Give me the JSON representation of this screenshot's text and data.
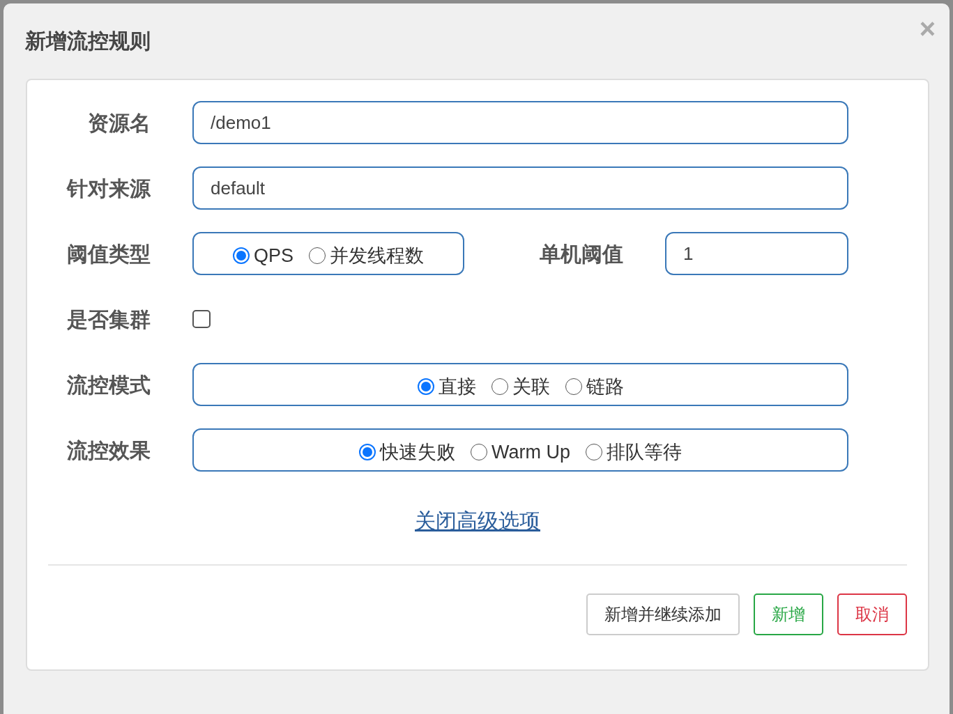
{
  "dialog": {
    "title": "新增流控规则",
    "close": "×"
  },
  "rows": [
    {
      "kind": "text",
      "label": "资源名",
      "value": "/demo1"
    },
    {
      "kind": "text",
      "label": "针对来源",
      "value": "default"
    },
    {
      "kind": "radio_input",
      "label": "阈值类型",
      "options": [
        {
          "label": "QPS",
          "selected": true
        },
        {
          "label": "并发线程数",
          "selected": false
        }
      ],
      "side_label": "单机阈值",
      "side_value": "1"
    },
    {
      "kind": "checkbox",
      "label": "是否集群",
      "checked": false
    },
    {
      "kind": "radio",
      "label": "流控模式",
      "options": [
        {
          "label": "直接",
          "selected": true
        },
        {
          "label": "关联",
          "selected": false
        },
        {
          "label": "链路",
          "selected": false
        }
      ]
    },
    {
      "kind": "radio",
      "label": "流控效果",
      "options": [
        {
          "label": "快速失败",
          "selected": true
        },
        {
          "label": "Warm Up",
          "selected": false
        },
        {
          "label": "排队等待",
          "selected": false
        }
      ]
    }
  ],
  "advanced_link": "关闭高级选项",
  "buttons": [
    {
      "label": "新增并继续添加",
      "kind": "default"
    },
    {
      "label": "新增",
      "kind": "success"
    },
    {
      "label": "取消",
      "kind": "danger"
    }
  ]
}
